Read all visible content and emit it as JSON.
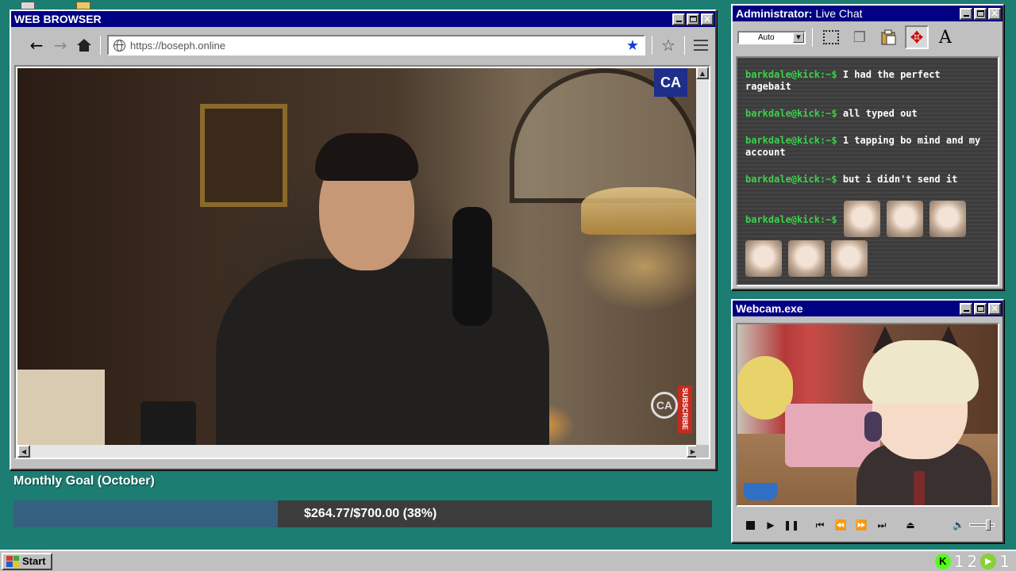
{
  "browser": {
    "title": "WEB BROWSER",
    "url": "https://boseph.online",
    "icons": {
      "back": "arrow-left-icon",
      "forward": "arrow-right-icon",
      "home": "home-icon",
      "site": "globe-icon",
      "bookmarked": "star-filled-icon",
      "bookmark": "star-outline-icon",
      "menu": "hamburger-menu-icon"
    },
    "video": {
      "logo_text": "CA",
      "subscribe_label": "SUBSCRIBE"
    }
  },
  "goal": {
    "label": "Monthly Goal (October)",
    "amount_text": "$264.77/$700.00 (38%)",
    "raised": 264.77,
    "target": 700.0,
    "percent": 38,
    "fill_color": "#36607f",
    "track_color": "#3c3c3c"
  },
  "chat": {
    "title_prefix": "Administrator:",
    "title": "Live Chat",
    "dropdown_value": "Auto",
    "tools": [
      "select-marquee-icon",
      "copy-icon",
      "paste-icon",
      "move-icon",
      "text-icon"
    ],
    "text_tool_glyph": "A",
    "prompt_color": "#3bd14b",
    "messages": [
      {
        "prompt": "barkdale@kick:~$",
        "text": "I had the perfect ragebait"
      },
      {
        "prompt": "barkdale@kick:~$",
        "text": "all typed out"
      },
      {
        "prompt": "barkdale@kick:~$",
        "text": "1 tapping bo mind and my account"
      },
      {
        "prompt": "barkdale@kick:~$",
        "text": "but i didn't send it"
      }
    ],
    "emote_message": {
      "prompt": "barkdale@kick:~$",
      "emote_count": 6
    }
  },
  "webcam": {
    "title": "Webcam.exe",
    "controls": [
      "stop-icon",
      "play-icon",
      "pause-icon",
      "skip-back-icon",
      "rewind-icon",
      "fast-forward-icon",
      "skip-forward-icon",
      "eject-icon",
      "volume-icon"
    ]
  },
  "taskbar": {
    "start_label": "Start",
    "tray": {
      "kick_letter": "K",
      "count_a": "1",
      "count_b": "2",
      "count_c": "1"
    }
  }
}
